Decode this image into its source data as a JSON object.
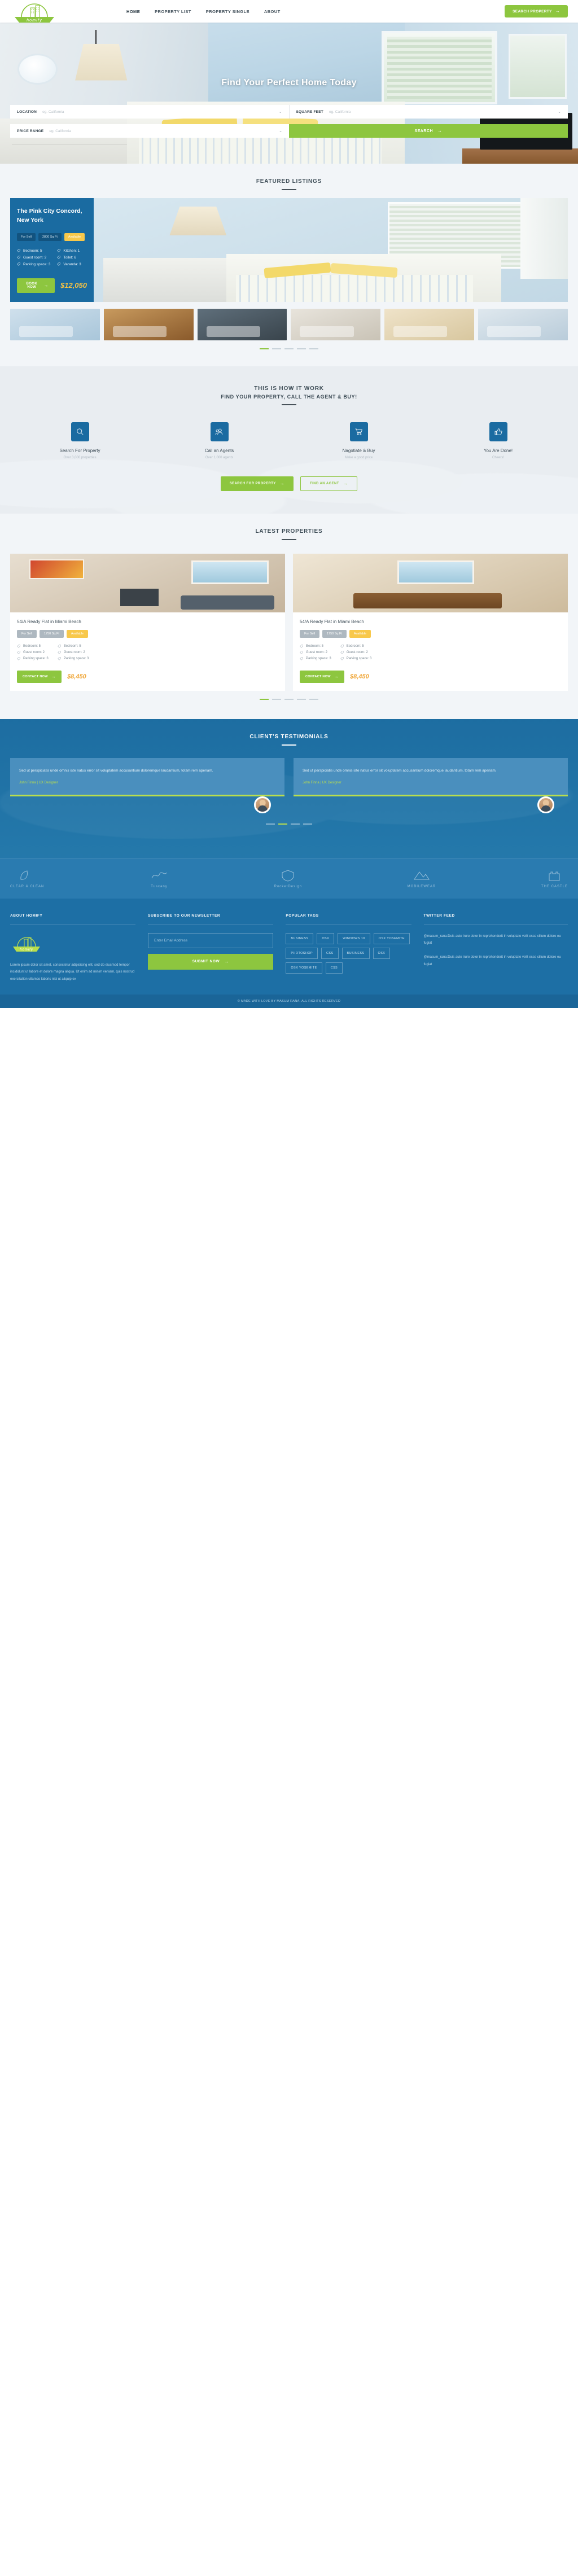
{
  "brand": {
    "name": "homify",
    "accent": "#8dc63f",
    "blue": "#1a6ba1",
    "amber": "#f5c243"
  },
  "header": {
    "nav": [
      {
        "label": "HOME",
        "active": true
      },
      {
        "label": "PROPERTY LIST",
        "active": false
      },
      {
        "label": "PROPERTY SINGLE",
        "active": false
      },
      {
        "label": "ABOUT",
        "active": false
      }
    ],
    "cta": "SEARCH PROPERTY"
  },
  "hero": {
    "title": "Find Your Perfect Home Today",
    "form": {
      "location_label": "LOCATION",
      "location_placeholder": "eg. California",
      "sqft_label": "SQUARE FEET",
      "sqft_placeholder": "eg. California",
      "price_label": "PRICE RANGE",
      "price_placeholder": "eg. California",
      "submit": "SEARCH"
    }
  },
  "featured": {
    "title": "FEATURED LISTINGS",
    "listing": {
      "title": "The Pink City Concord, New York",
      "chips": [
        "For Sell",
        "2800 Sq Ft",
        "Available"
      ],
      "specs_left": [
        "Bedroom: 5",
        "Guest room: 2",
        "Parking space: 3"
      ],
      "specs_right": [
        "Kitchen: 1",
        "Toilet: 6",
        "Varanda: 3"
      ],
      "cta": "BOOK NOW",
      "price": "$12,050"
    },
    "thumbs": [
      "thumb-1",
      "thumb-2",
      "thumb-3",
      "thumb-4",
      "thumb-5",
      "thumb-6"
    ],
    "dots": 5,
    "active_dot": 0
  },
  "how": {
    "title": "THIS IS HOW IT WORK",
    "subtitle": "FIND YOUR PROPERTY, CALL THE AGENT & BUY!",
    "steps": [
      {
        "icon": "search-icon",
        "title": "Search For Property",
        "sub": "Over 3,000 properties"
      },
      {
        "icon": "agents-icon",
        "title": "Call an Agents",
        "sub": "Over 1,000 agents"
      },
      {
        "icon": "cart-icon",
        "title": "Nagotiate & Buy",
        "sub": "Make a good price"
      },
      {
        "icon": "thumbs-up-icon",
        "title": "You Are Done!",
        "sub": "Cheers!"
      }
    ],
    "btn_primary": "SEARCH FOR PROPERTY",
    "btn_secondary": "FIND AN AGENT"
  },
  "latest": {
    "title": "LATEST PROPERTIES",
    "cards": [
      {
        "title": "54/A Ready Flat in Miami Beach",
        "chips": [
          "For Sell",
          "1750 Sq Ft",
          "Available"
        ],
        "specs_left": [
          "Bedroom: 5",
          "Guest room: 2",
          "Parking space: 3"
        ],
        "specs_right": [
          "Bedroom: 5",
          "Guest room: 2",
          "Parking space: 3"
        ],
        "cta": "CONTACT NOW",
        "price": "$8,450"
      },
      {
        "title": "54/A Ready Flat in Miami Beach",
        "chips": [
          "For Sell",
          "1750 Sq Ft",
          "Available"
        ],
        "specs_left": [
          "Bedroom: 5",
          "Guest room: 2",
          "Parking space: 3"
        ],
        "specs_right": [
          "Bedroom: 5",
          "Guest room: 2",
          "Parking space: 3"
        ],
        "cta": "CONTACT NOW",
        "price": "$8,450"
      }
    ],
    "dots": 5,
    "active_dot": 0
  },
  "testimonials": {
    "title": "CLIENT'S TESTIMONIALS",
    "items": [
      {
        "quote": "Sed ut perspiciatis unde omnis iste natus error sit voluptatem accusantium doloremque laudantium, totam rem aperiam.",
        "name": "John Finna | UX Designer"
      },
      {
        "quote": "Sed ut perspiciatis unde omnis iste natus error sit voluptatem accusantium doloremque laudantium, totam rem aperiam.",
        "name": "John Finna | UX Designer"
      }
    ],
    "dots": 4,
    "active_dot": 1
  },
  "brands": [
    {
      "name": "CLEAR & CLEAN"
    },
    {
      "name": "Tuscany"
    },
    {
      "name": "RocketDesign"
    },
    {
      "name": "MOBILEWEAR"
    },
    {
      "name": "THE CASTLE"
    }
  ],
  "footer": {
    "about": {
      "heading": "ABOUT HOMIFY",
      "text": "Lorem ipsum dolor sit amet, consectetur adipisicing elit, sed do eiusmod tempor incididunt ut labore et dolore magna aliqua. Ut enim ad minim veniam, quis nostrud exercitation ullamco laboris nisi ut aliquip ex"
    },
    "newsletter": {
      "heading": "SUBSCRIBE TO OUR NEWSLETTER",
      "placeholder": "Enter Email Address",
      "submit": "SUBMIT NOW"
    },
    "tags": {
      "heading": "POPULAR TAGS",
      "items": [
        "BUSINESS",
        "OSX",
        "WINDOWS 10",
        "OSX YOSEMITE",
        "PHOTOSHOP",
        "CSS",
        "BUSINESS",
        "OSX",
        "OSX YOSEMITE",
        "CSS"
      ]
    },
    "twitter": {
      "heading": "TWITTER FEED",
      "items": [
        "@masum_rana:Duis aute irure dolor in reprehenderit in voluptate velit esse cillum dolore eu fugiat",
        "@masum_rana:Duis aute irure dolor in reprehenderit in voluptate velit esse cillum dolore eu fugiat"
      ]
    },
    "copyright": "© MADE WITH LOVE BY MASUM RANA. ALL RIGHTS RESERVED"
  }
}
